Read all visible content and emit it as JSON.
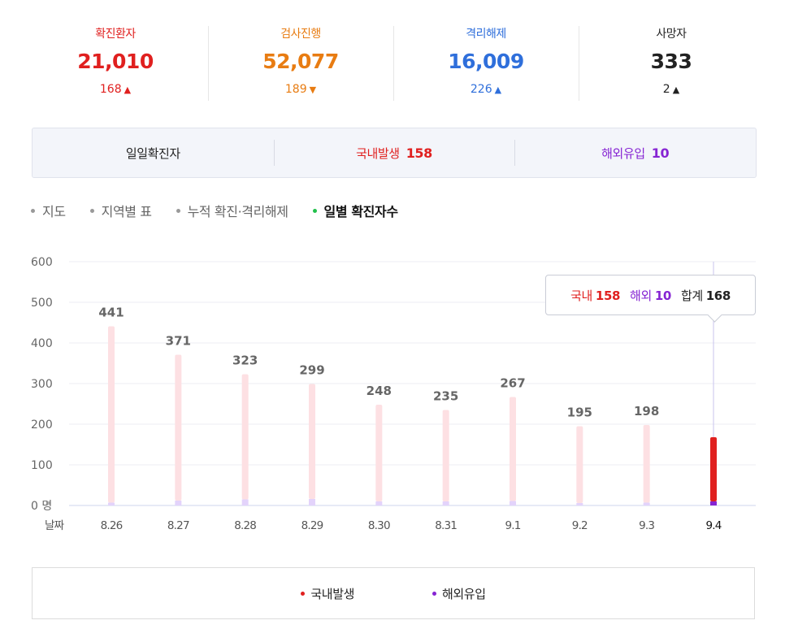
{
  "colors": {
    "red": "#e0201f",
    "orange": "#e87c12",
    "blue": "#2f6fdb",
    "black": "#222222",
    "purple": "#8624d3",
    "green": "#21c04b"
  },
  "stats": [
    {
      "label": "확진환자",
      "value": "21,010",
      "delta": "168",
      "arrow": "▲",
      "color": "#e0201f"
    },
    {
      "label": "검사진행",
      "value": "52,077",
      "delta": "189",
      "arrow": "▼",
      "color": "#e87c12"
    },
    {
      "label": "격리해제",
      "value": "16,009",
      "delta": "226",
      "arrow": "▲",
      "color": "#2f6fdb"
    },
    {
      "label": "사망자",
      "value": "333",
      "delta": "2",
      "arrow": "▲",
      "color": "#222222"
    }
  ],
  "summary": {
    "daily_label": "일일확진자",
    "domestic_label": "국내발생",
    "domestic_value": "158",
    "overseas_label": "해외유입",
    "overseas_value": "10"
  },
  "tabs": [
    {
      "label": "지도",
      "active": false
    },
    {
      "label": "지역별 표",
      "active": false
    },
    {
      "label": "누적 확진·격리해제",
      "active": false
    },
    {
      "label": "일별 확진자수",
      "active": true
    }
  ],
  "tooltip": {
    "domestic_label": "국내",
    "domestic_value": "158",
    "overseas_label": "해외",
    "overseas_value": "10",
    "total_label": "합계",
    "total_value": "168"
  },
  "legend": [
    {
      "label": "국내발생",
      "color": "#e0201f"
    },
    {
      "label": "해외유입",
      "color": "#8624d3"
    }
  ],
  "chart_data": {
    "type": "bar",
    "ylim": [
      0,
      600
    ],
    "yticks": [
      "0 명",
      "100",
      "200",
      "300",
      "400",
      "500",
      "600"
    ],
    "xaxis_label": "날짜",
    "categories": [
      "8.26",
      "8.27",
      "8.28",
      "8.29",
      "8.30",
      "8.31",
      "9.1",
      "9.2",
      "9.3",
      "9.4"
    ],
    "totals": [
      441,
      371,
      323,
      299,
      248,
      235,
      267,
      195,
      198,
      168
    ],
    "total_labels": [
      "441",
      "371",
      "323",
      "299",
      "248",
      "235",
      "267",
      "195",
      "198",
      ""
    ],
    "series": [
      {
        "name": "국내발생",
        "values": [
          434,
          359,
          308,
          283,
          238,
          225,
          256,
          189,
          191,
          158
        ]
      },
      {
        "name": "해외유입",
        "values": [
          7,
          12,
          15,
          16,
          10,
          10,
          11,
          6,
          7,
          10
        ]
      }
    ],
    "highlight_index": 9,
    "stacked": true,
    "grid": true
  }
}
